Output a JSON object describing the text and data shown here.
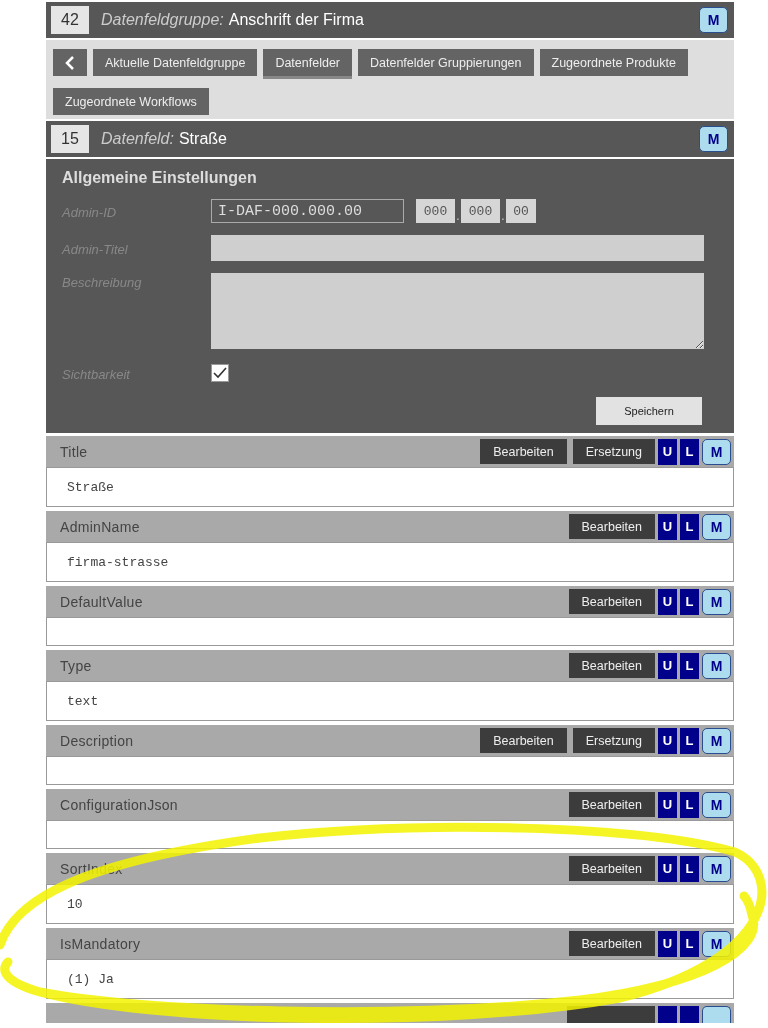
{
  "group_header": {
    "number": "42",
    "label": "Datenfeldgruppe:",
    "title": "Anschrift der Firma",
    "badge": "M"
  },
  "nav": {
    "tabs": [
      {
        "label": "Aktuelle Datenfeldgruppe",
        "selected": false
      },
      {
        "label": "Datenfelder",
        "selected": true
      },
      {
        "label": "Datenfelder Gruppierungen",
        "selected": false
      },
      {
        "label": "Zugeordnete Produkte",
        "selected": false
      },
      {
        "label": "Zugeordnete Workflows",
        "selected": false
      }
    ]
  },
  "field_header": {
    "number": "15",
    "label": "Datenfeld:",
    "title": "Straße",
    "badge": "M"
  },
  "settings": {
    "title": "Allgemeine Einstellungen",
    "admin_id": {
      "label": "Admin-ID",
      "value": "I-DAF-000.000.00",
      "parts": [
        "000",
        "000",
        "00"
      ],
      "separator": "."
    },
    "admin_title": {
      "label": "Admin-Titel"
    },
    "description": {
      "label": "Beschreibung"
    },
    "visibility": {
      "label": "Sichtbarkeit",
      "checked": true
    },
    "save": "Speichern"
  },
  "properties": [
    {
      "name": "Title",
      "actions": [
        "Bearbeiten",
        "Ersetzung"
      ],
      "value": "Straße",
      "badges": [
        {
          "label": "U",
          "selected": false
        },
        {
          "label": "L",
          "selected": false
        },
        {
          "label": "M",
          "selected": true
        }
      ]
    },
    {
      "name": "AdminName",
      "actions": [
        "Bearbeiten"
      ],
      "value": "firma-strasse",
      "badges": [
        {
          "label": "U",
          "selected": false
        },
        {
          "label": "L",
          "selected": false
        },
        {
          "label": "M",
          "selected": true
        }
      ]
    },
    {
      "name": "DefaultValue",
      "actions": [
        "Bearbeiten"
      ],
      "badges": [
        {
          "label": "U",
          "selected": false
        },
        {
          "label": "L",
          "selected": false
        },
        {
          "label": "M",
          "selected": true
        }
      ]
    },
    {
      "name": "Type",
      "actions": [
        "Bearbeiten"
      ],
      "value": "text",
      "badges": [
        {
          "label": "U",
          "selected": false
        },
        {
          "label": "L",
          "selected": false
        },
        {
          "label": "M",
          "selected": true
        }
      ]
    },
    {
      "name": "Description",
      "actions": [
        "Bearbeiten",
        "Ersetzung"
      ],
      "badges": [
        {
          "label": "U",
          "selected": false
        },
        {
          "label": "L",
          "selected": false
        },
        {
          "label": "M",
          "selected": true
        }
      ]
    },
    {
      "name": "ConfigurationJson",
      "actions": [
        "Bearbeiten"
      ],
      "badges": [
        {
          "label": "U",
          "selected": false
        },
        {
          "label": "L",
          "selected": false
        },
        {
          "label": "M",
          "selected": true
        }
      ]
    },
    {
      "name": "SortIndex",
      "actions": [
        "Bearbeiten"
      ],
      "value": "10",
      "badges": [
        {
          "label": "U",
          "selected": false
        },
        {
          "label": "L",
          "selected": false
        },
        {
          "label": "M",
          "selected": true
        }
      ]
    },
    {
      "name": "IsMandatory",
      "actions": [
        "Bearbeiten"
      ],
      "value": "(1) Ja",
      "badges": [
        {
          "label": "U",
          "selected": false
        },
        {
          "label": "L",
          "selected": false
        },
        {
          "label": "M",
          "selected": true
        }
      ]
    }
  ],
  "cut_row": {
    "kind": "header"
  },
  "annotation": {
    "kind": "scribble"
  }
}
